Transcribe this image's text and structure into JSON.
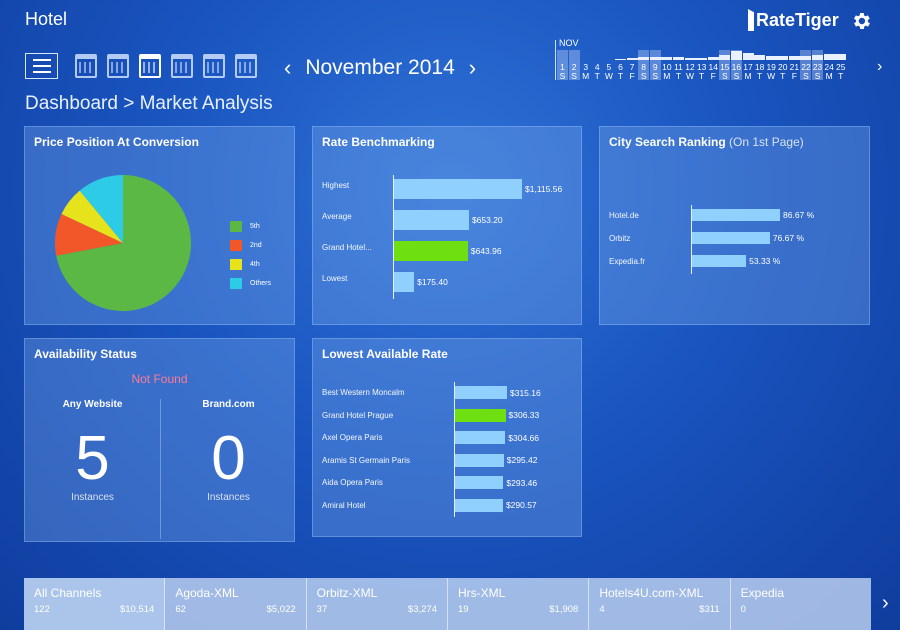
{
  "app": {
    "title": "Hotel",
    "brand": "RateTiger"
  },
  "toolbar": {
    "month_label": "November 2014",
    "prev": "‹",
    "next": "›"
  },
  "date_strip": {
    "month_abbr": "NOV",
    "days": [
      {
        "num": "1",
        "dow": "S",
        "level": 0.0,
        "weekend": true
      },
      {
        "num": "2",
        "dow": "S",
        "level": 0.0,
        "weekend": true
      },
      {
        "num": "3",
        "dow": "M",
        "level": 0.0,
        "weekend": false
      },
      {
        "num": "4",
        "dow": "T",
        "level": 0.0,
        "weekend": false
      },
      {
        "num": "5",
        "dow": "W",
        "level": 0.0,
        "weekend": false
      },
      {
        "num": "6",
        "dow": "T",
        "level": 0.05,
        "weekend": false
      },
      {
        "num": "7",
        "dow": "F",
        "level": 0.1,
        "weekend": false
      },
      {
        "num": "8",
        "dow": "S",
        "level": 0.15,
        "weekend": true
      },
      {
        "num": "9",
        "dow": "S",
        "level": 0.15,
        "weekend": true
      },
      {
        "num": "10",
        "dow": "M",
        "level": 0.15,
        "weekend": false
      },
      {
        "num": "11",
        "dow": "T",
        "level": 0.15,
        "weekend": false
      },
      {
        "num": "12",
        "dow": "W",
        "level": 0.1,
        "weekend": false
      },
      {
        "num": "13",
        "dow": "T",
        "level": 0.1,
        "weekend": false
      },
      {
        "num": "14",
        "dow": "F",
        "level": 0.15,
        "weekend": false
      },
      {
        "num": "15",
        "dow": "S",
        "level": 0.25,
        "weekend": true
      },
      {
        "num": "16",
        "dow": "S",
        "level": 0.45,
        "weekend": true
      },
      {
        "num": "17",
        "dow": "M",
        "level": 0.35,
        "weekend": false
      },
      {
        "num": "18",
        "dow": "T",
        "level": 0.25,
        "weekend": false
      },
      {
        "num": "19",
        "dow": "W",
        "level": 0.2,
        "weekend": false
      },
      {
        "num": "20",
        "dow": "T",
        "level": 0.2,
        "weekend": false
      },
      {
        "num": "21",
        "dow": "F",
        "level": 0.2,
        "weekend": false
      },
      {
        "num": "22",
        "dow": "S",
        "level": 0.2,
        "weekend": true
      },
      {
        "num": "23",
        "dow": "S",
        "level": 0.25,
        "weekend": true
      },
      {
        "num": "24",
        "dow": "M",
        "level": 0.3,
        "weekend": false
      },
      {
        "num": "25",
        "dow": "T",
        "level": 0.3,
        "weekend": false
      }
    ]
  },
  "breadcrumb": "Dashboard > Market Analysis",
  "price_position": {
    "title": "Price Position At Conversion",
    "legend": [
      {
        "label": "5th",
        "color": "#5bb844"
      },
      {
        "label": "2nd",
        "color": "#f2572a"
      },
      {
        "label": "4th",
        "color": "#e6e21c"
      },
      {
        "label": "Others",
        "color": "#2dcbe6"
      }
    ]
  },
  "rate_benchmarking": {
    "title": "Rate Benchmarking",
    "rows": [
      {
        "label": "Highest",
        "value": "$1,115.56",
        "amount": 1115.56,
        "color": "#8fd0ff"
      },
      {
        "label": "Average",
        "value": "$653.20",
        "amount": 653.2,
        "color": "#8fd0ff"
      },
      {
        "label": "Grand Hotel...",
        "value": "$643.96",
        "amount": 643.96,
        "color": "#6ee012"
      },
      {
        "label": "Lowest",
        "value": "$175.40",
        "amount": 175.4,
        "color": "#8fd0ff"
      }
    ]
  },
  "city_search": {
    "title": "City Search Ranking",
    "subtitle": "(On 1st Page)",
    "rows": [
      {
        "label": "Hotel.de",
        "value": "86.67 %",
        "amount": 86.67
      },
      {
        "label": "Orbitz",
        "value": "76.67 %",
        "amount": 76.67
      },
      {
        "label": "Expedia.fr",
        "value": "53.33 %",
        "amount": 53.33
      }
    ]
  },
  "availability": {
    "title": "Availability Status",
    "status": "Not Found",
    "columns": [
      {
        "header": "Any Website",
        "count": "5",
        "unit": "Instances"
      },
      {
        "header": "Brand.com",
        "count": "0",
        "unit": "Instances"
      }
    ]
  },
  "lowest_rate": {
    "title": "Lowest Available Rate",
    "rows": [
      {
        "label": "Best Western Moncalm",
        "value": "$315.16",
        "amount": 315.16,
        "color": "#8fd0ff"
      },
      {
        "label": "Grand Hotel Prague",
        "value": "$306.33",
        "amount": 306.33,
        "color": "#6ee012"
      },
      {
        "label": "Axel Opera Paris",
        "value": "$304.66",
        "amount": 304.66,
        "color": "#8fd0ff"
      },
      {
        "label": "Aramis St Germain Paris",
        "value": "$295.42",
        "amount": 295.42,
        "color": "#8fd0ff"
      },
      {
        "label": "Aida Opera Paris",
        "value": "$293.46",
        "amount": 293.46,
        "color": "#8fd0ff"
      },
      {
        "label": "Amiral Hotel",
        "value": "$290.57",
        "amount": 290.57,
        "color": "#8fd0ff"
      }
    ]
  },
  "channels": [
    {
      "name": "All Channels",
      "count": "122",
      "amount": "$10,514"
    },
    {
      "name": "Agoda-XML",
      "count": "62",
      "amount": "$5,022"
    },
    {
      "name": "Orbitz-XML",
      "count": "37",
      "amount": "$3,274"
    },
    {
      "name": "Hrs-XML",
      "count": "19",
      "amount": "$1,908"
    },
    {
      "name": "Hotels4U.com-XML",
      "count": "4",
      "amount": "$311"
    },
    {
      "name": "Expedia",
      "count": "0",
      "amount": ""
    }
  ],
  "chart_data": {
    "type": "pie",
    "title": "Price Position At Conversion",
    "categories": [
      "5th",
      "2nd",
      "4th",
      "Others"
    ],
    "values": [
      72,
      10,
      7,
      11
    ],
    "colors": [
      "#5bb844",
      "#f2572a",
      "#e6e21c",
      "#2dcbe6"
    ]
  }
}
